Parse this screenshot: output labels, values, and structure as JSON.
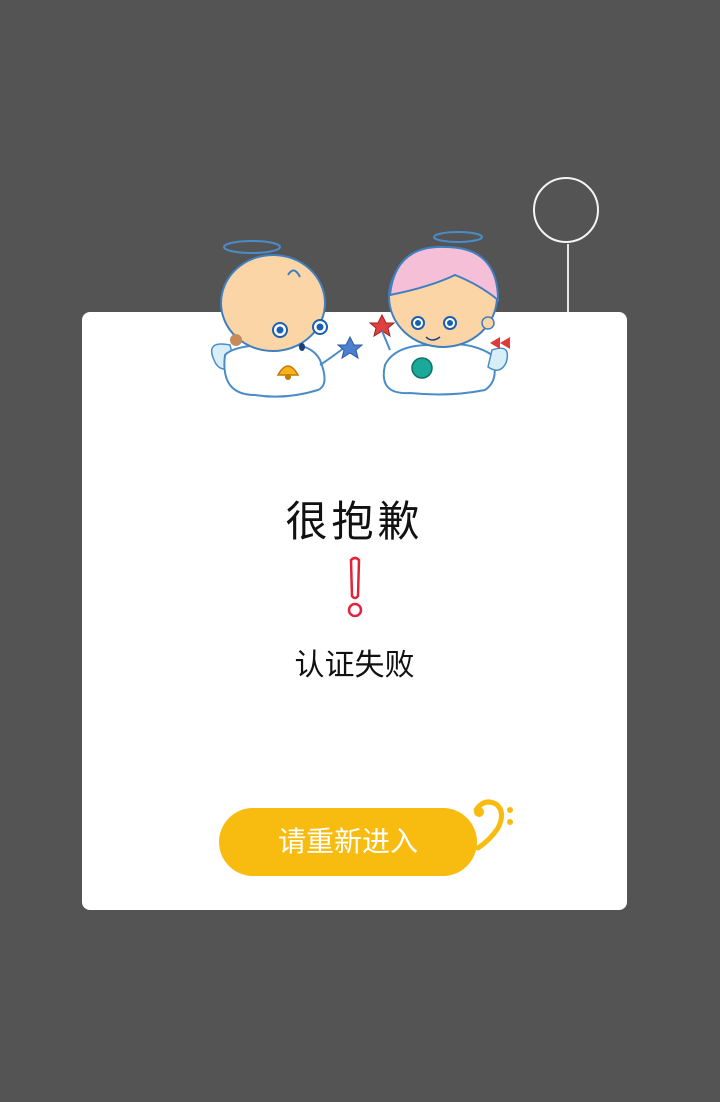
{
  "dialog": {
    "title": "很抱歉",
    "message": "认证失败",
    "button_label": "请重新进入"
  },
  "colors": {
    "background": "#545454",
    "card": "#ffffff",
    "button": "#f8bb10",
    "exclamation": "#e0243c"
  },
  "icons": {
    "hanging_ring": "ring-icon",
    "illustration": "angel-babies-illustration",
    "alert": "exclamation-icon",
    "music": "bass-clef-icon"
  }
}
